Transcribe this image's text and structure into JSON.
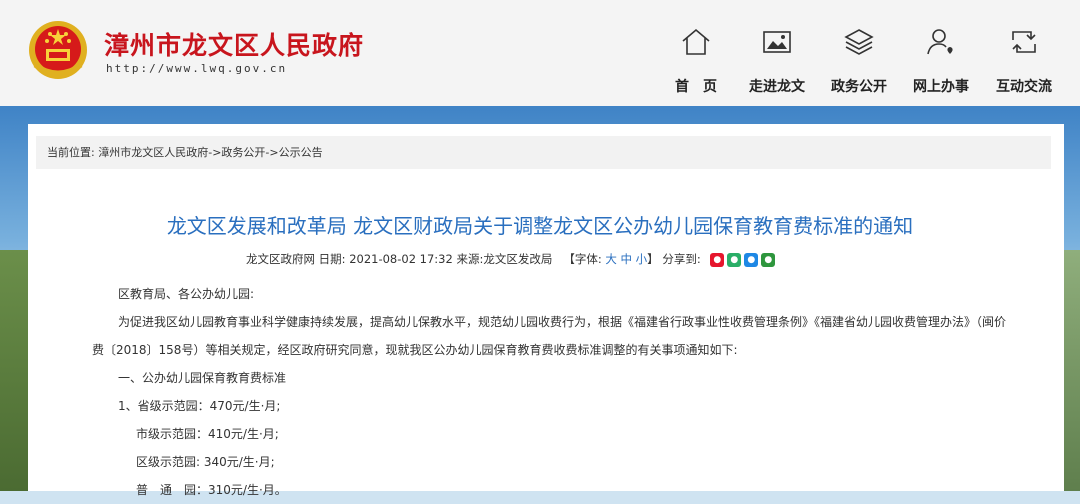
{
  "header": {
    "site_title": "漳州市龙文区人民政府",
    "site_url": "http://www.lwq.gov.cn",
    "nav": [
      {
        "label": "首　页",
        "icon": "home-icon"
      },
      {
        "label": "走进龙文",
        "icon": "image-icon"
      },
      {
        "label": "政务公开",
        "icon": "layers-icon"
      },
      {
        "label": "网上办事",
        "icon": "user-heart-icon"
      },
      {
        "label": "互动交流",
        "icon": "exchange-icon"
      }
    ]
  },
  "breadcrumb": {
    "lead": "当前位置:",
    "items": [
      "漳州市龙文区人民政府",
      "政务公开",
      "公示公告"
    ],
    "separator": "->"
  },
  "article": {
    "title": "龙文区发展和改革局  龙文区财政局关于调整龙文区公办幼儿园保育教育费标准的通知",
    "meta": {
      "site": "龙文区政府网",
      "date_label": "日期:",
      "date": "2021-08-02 17:32",
      "source_label": "来源:",
      "source": "龙文区发改局",
      "font_label_open": "【字体:",
      "font_large": "大",
      "font_medium": "中",
      "font_small": "小",
      "font_label_close": "】",
      "share_label": "分享到:"
    },
    "paragraphs": [
      "区教育局、各公办幼儿园:",
      "为促进我区幼儿园教育事业科学健康持续发展，提高幼儿保教水平，规范幼儿园收费行为，根据《福建省行政事业性收费管理条例》《福建省幼儿园收费管理办法》（闽价",
      "费〔2018〕158号）等相关规定，经区政府研究同意，现就我区公办幼儿园保育教育费收费标准调整的有关事项通知如下:",
      "一、公办幼儿园保育教育费标准",
      "1、省级示范园：470元/生·月;",
      "市级示范园：410元/生·月;",
      "区级示范园: 340元/生·月;",
      "普　通　园：310元/生·月。"
    ]
  },
  "colors": {
    "title_red": "#c8151d",
    "link_blue": "#2a6fbf",
    "share_weibo": "#e6162d",
    "share_wechat": "#2aae67",
    "share_qq": "#1e88e5",
    "share_douban": "#2e963d"
  }
}
